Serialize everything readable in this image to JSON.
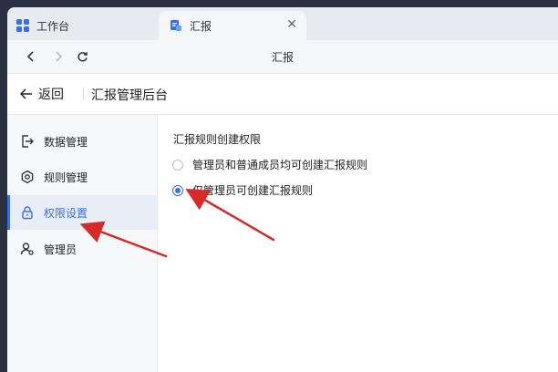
{
  "tabs": [
    {
      "label": "工作台",
      "active": false
    },
    {
      "label": "汇报",
      "active": true
    }
  ],
  "nav": {
    "title": "汇报"
  },
  "header": {
    "back_label": "返回",
    "title": "汇报管理后台"
  },
  "sidebar": {
    "items": [
      {
        "label": "数据管理",
        "icon": "exit-icon",
        "active": false
      },
      {
        "label": "规则管理",
        "icon": "gear-icon",
        "active": false
      },
      {
        "label": "权限设置",
        "icon": "lock-icon",
        "active": true
      },
      {
        "label": "管理员",
        "icon": "admin-user-icon",
        "active": false
      }
    ]
  },
  "content": {
    "section_title": "汇报规则创建权限",
    "options": [
      {
        "label": "管理员和普通成员均可创建汇报规则",
        "checked": false
      },
      {
        "label": "仅管理员可创建汇报规则",
        "checked": true
      }
    ]
  },
  "colors": {
    "accent": "#3a6ee8",
    "annotation_arrow": "#d42a2a"
  }
}
